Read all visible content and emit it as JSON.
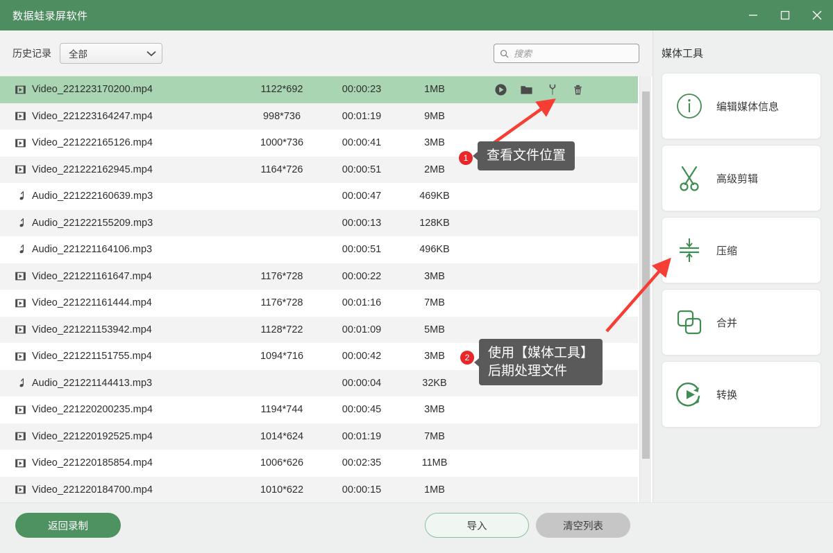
{
  "window": {
    "title": "数据蛙录屏软件",
    "accent_color": "#4d8d5f",
    "controls": {
      "minimize": "minimize-icon",
      "maximize": "maximize-icon",
      "close": "close-icon"
    }
  },
  "toolbar": {
    "history_label": "历史记录",
    "history_value": "全部",
    "search_placeholder": "搜索",
    "search_value": ""
  },
  "file_list": {
    "rows": [
      {
        "type": "video",
        "name": "Video_221223170200.mp4",
        "resolution": "1122*692",
        "duration": "00:00:23",
        "size": "1MB",
        "selected": true
      },
      {
        "type": "video",
        "name": "Video_221223164247.mp4",
        "resolution": "998*736",
        "duration": "00:01:19",
        "size": "9MB",
        "selected": false
      },
      {
        "type": "video",
        "name": "Video_221222165126.mp4",
        "resolution": "1000*736",
        "duration": "00:00:41",
        "size": "3MB",
        "selected": false
      },
      {
        "type": "video",
        "name": "Video_221222162945.mp4",
        "resolution": "1164*726",
        "duration": "00:00:51",
        "size": "2MB",
        "selected": false
      },
      {
        "type": "audio",
        "name": "Audio_221222160639.mp3",
        "resolution": "",
        "duration": "00:00:47",
        "size": "469KB",
        "selected": false
      },
      {
        "type": "audio",
        "name": "Audio_221222155209.mp3",
        "resolution": "",
        "duration": "00:00:13",
        "size": "128KB",
        "selected": false
      },
      {
        "type": "audio",
        "name": "Audio_221221164106.mp3",
        "resolution": "",
        "duration": "00:00:51",
        "size": "496KB",
        "selected": false
      },
      {
        "type": "video",
        "name": "Video_221221161647.mp4",
        "resolution": "1176*728",
        "duration": "00:00:22",
        "size": "3MB",
        "selected": false
      },
      {
        "type": "video",
        "name": "Video_221221161444.mp4",
        "resolution": "1176*728",
        "duration": "00:01:16",
        "size": "7MB",
        "selected": false
      },
      {
        "type": "video",
        "name": "Video_221221153942.mp4",
        "resolution": "1128*722",
        "duration": "00:01:09",
        "size": "5MB",
        "selected": false
      },
      {
        "type": "video",
        "name": "Video_221221151755.mp4",
        "resolution": "1094*716",
        "duration": "00:00:42",
        "size": "3MB",
        "selected": false
      },
      {
        "type": "audio",
        "name": "Audio_221221144413.mp3",
        "resolution": "",
        "duration": "00:00:04",
        "size": "32KB",
        "selected": false
      },
      {
        "type": "video",
        "name": "Video_221220200235.mp4",
        "resolution": "1194*744",
        "duration": "00:00:45",
        "size": "3MB",
        "selected": false
      },
      {
        "type": "video",
        "name": "Video_221220192525.mp4",
        "resolution": "1014*624",
        "duration": "00:01:19",
        "size": "7MB",
        "selected": false
      },
      {
        "type": "video",
        "name": "Video_221220185854.mp4",
        "resolution": "1006*626",
        "duration": "00:02:35",
        "size": "11MB",
        "selected": false
      },
      {
        "type": "video",
        "name": "Video_221220184700.mp4",
        "resolution": "1010*622",
        "duration": "00:00:15",
        "size": "1MB",
        "selected": false
      }
    ],
    "row_actions": [
      "play-icon",
      "folder-icon",
      "wrench-icon",
      "trash-icon"
    ]
  },
  "media_tools": {
    "title": "媒体工具",
    "items": [
      {
        "label": "编辑媒体信息",
        "icon": "info-circle-icon"
      },
      {
        "label": "高级剪辑",
        "icon": "scissors-icon"
      },
      {
        "label": "压缩",
        "icon": "compress-icon"
      },
      {
        "label": "合并",
        "icon": "merge-squares-icon"
      },
      {
        "label": "转换",
        "icon": "convert-play-icon"
      }
    ]
  },
  "bottom_bar": {
    "back_label": "返回录制",
    "import_label": "导入",
    "clear_label": "清空列表"
  },
  "annotations": [
    {
      "number": "1",
      "text": "查看文件位置"
    },
    {
      "number": "2",
      "text": "使用【媒体工具】\n后期处理文件"
    }
  ]
}
